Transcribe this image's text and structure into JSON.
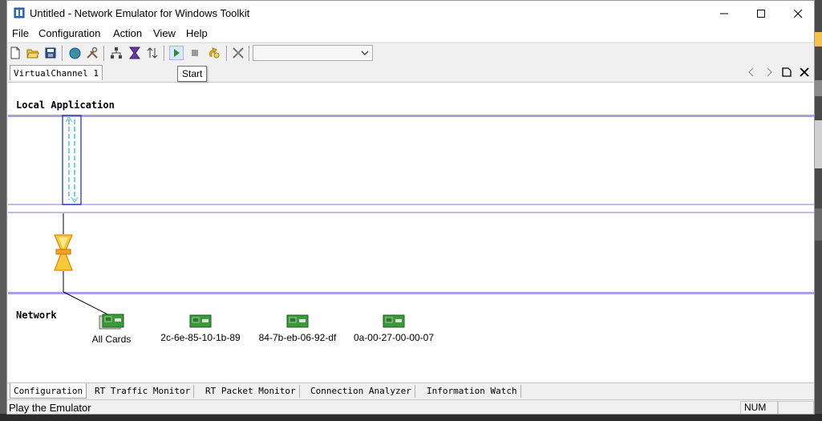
{
  "window": {
    "title": "Untitled - Network Emulator for Windows Toolkit"
  },
  "menu": [
    "File",
    "Configuration",
    "Action",
    "View",
    "Help"
  ],
  "toolbar": {
    "buttons": [
      "new-icon",
      "open-icon",
      "save-icon",
      "globe-icon",
      "tools-icon",
      "topology-icon",
      "filter-icon",
      "sort-icon",
      "start-icon",
      "stop-icon",
      "reload-icon",
      "disconnect-icon"
    ],
    "combo_value": "",
    "tooltip": "Start"
  },
  "doc_tab": {
    "label": "VirtualChannel 1"
  },
  "canvas": {
    "local_label": "Local Application",
    "network_label": "Network",
    "cards": [
      "All Cards",
      "2c-6e-85-10-1b-89",
      "84-7b-eb-06-92-df",
      "0a-00-27-00-00-07"
    ]
  },
  "bottom_tabs": [
    "Configuration",
    "RT Traffic Monitor",
    "RT Packet Monitor",
    "Connection Analyzer",
    "Information Watch"
  ],
  "status": {
    "text": "Play the Emulator",
    "num": "NUM"
  },
  "colors": {
    "lane_line": "#a8a0e8",
    "accent": "#0078d7"
  }
}
